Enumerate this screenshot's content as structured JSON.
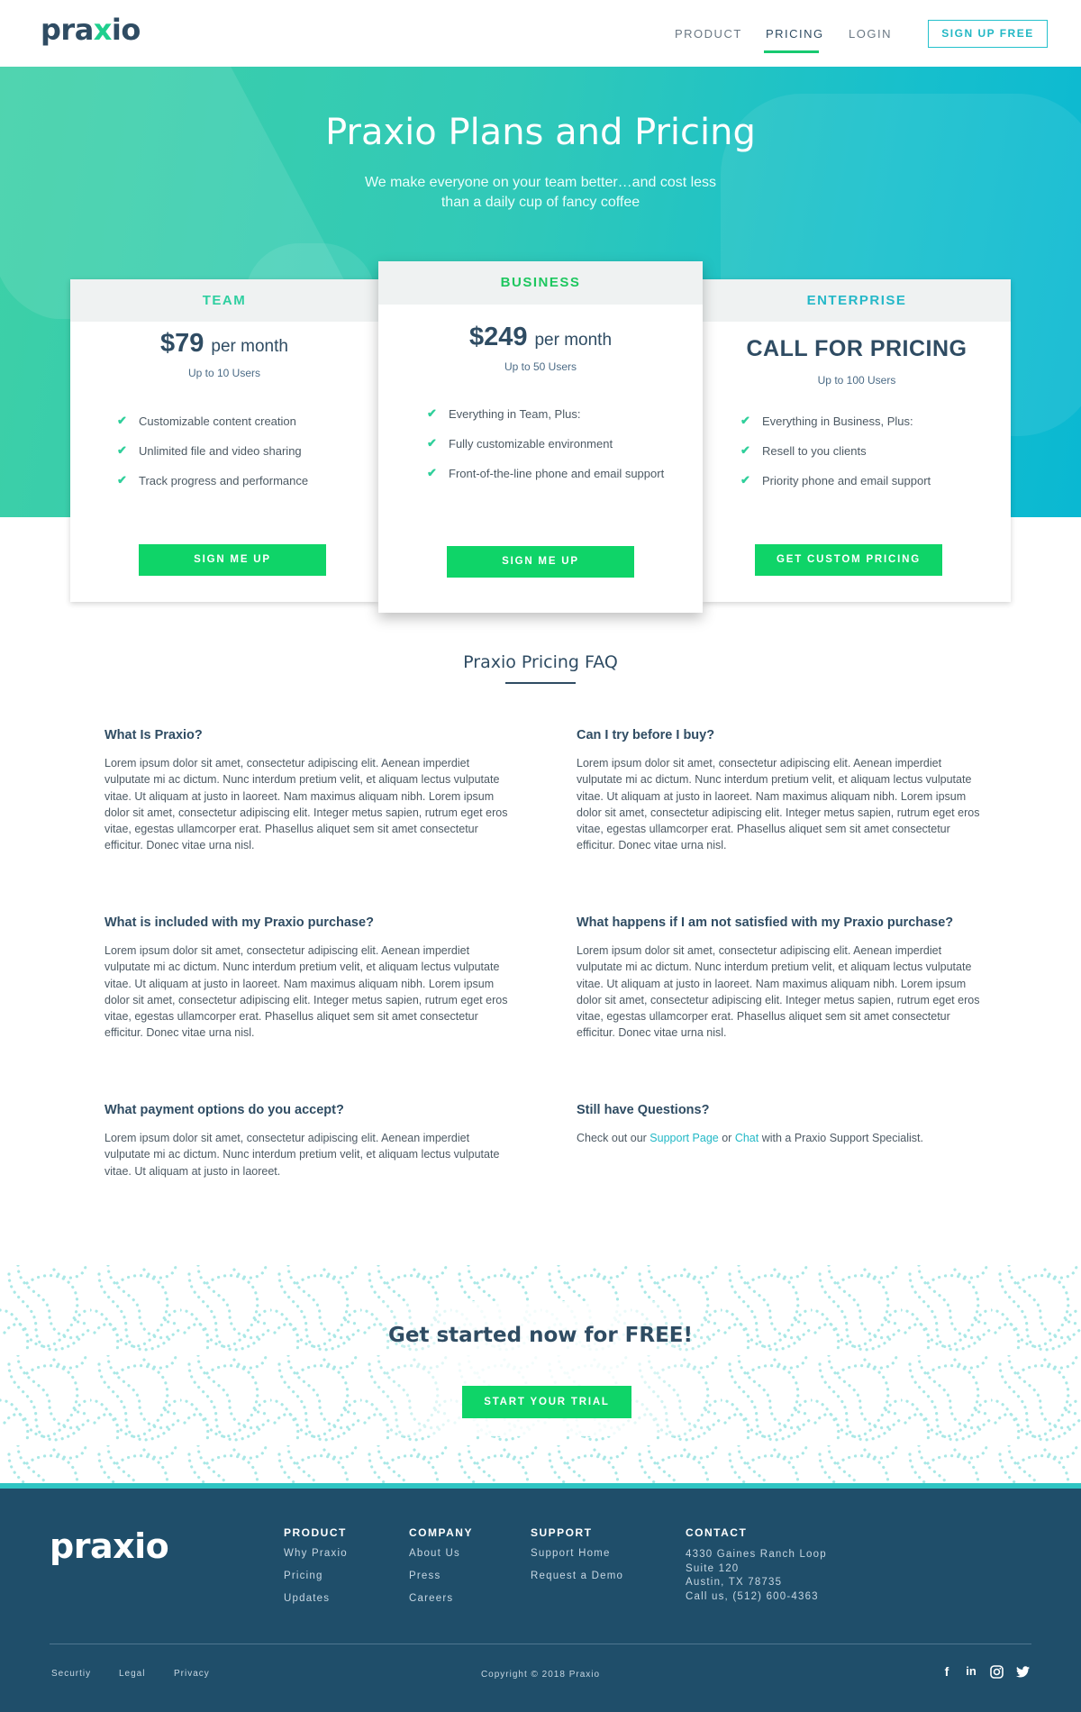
{
  "header": {
    "logo_pre": "pra",
    "logo_x": "x",
    "logo_post": "io",
    "nav": [
      "PRODUCT",
      "PRICING",
      "LOGIN"
    ],
    "signup": "SIGN UP FREE",
    "active_nav": "PRICING"
  },
  "hero": {
    "title": "Praxio Plans and Pricing",
    "subtitle": "We make everyone on your team better…and cost less than a daily cup of fancy coffee"
  },
  "plans": [
    {
      "name": "TEAM",
      "price": "$79",
      "per": "per month",
      "users": "Up to 10 Users",
      "features": [
        "Customizable content creation",
        "Unlimited file and video sharing",
        "Track progress and performance"
      ],
      "button": "SIGN ME UP"
    },
    {
      "name": "BUSINESS",
      "price": "$249",
      "per": "per month",
      "users": "Up to 50 Users",
      "features": [
        "Everything in Team, Plus:",
        "Fully customizable environment",
        "Front-of-the-line phone and email support"
      ],
      "button": "SIGN ME UP"
    },
    {
      "name": "ENTERPRISE",
      "price_text": "CALL FOR PRICING",
      "users": "Up to 100 Users",
      "features": [
        "Everything in Business, Plus:",
        "Resell to you clients",
        "Priority phone and email support"
      ],
      "button": "GET CUSTOM PRICING"
    }
  ],
  "faq": {
    "title": "Praxio Pricing FAQ",
    "items": [
      {
        "q": "What Is Praxio?",
        "a": "Lorem ipsum dolor sit amet, consectetur adipiscing elit. Aenean imperdiet vulputate mi ac dictum. Nunc interdum pretium velit, et aliquam lectus vulputate vitae. Ut aliquam at justo in laoreet. Nam maximus aliquam nibh. Lorem ipsum dolor sit amet, consectetur adipiscing elit. Integer metus sapien, rutrum eget eros vitae, egestas ullamcorper erat. Phasellus aliquet sem sit amet consectetur efficitur. Donec vitae urna nisl."
      },
      {
        "q": "Can I try before I buy?",
        "a": "Lorem ipsum dolor sit amet, consectetur adipiscing elit. Aenean imperdiet vulputate mi ac dictum. Nunc interdum pretium velit, et aliquam lectus vulputate vitae. Ut aliquam at justo in laoreet. Nam maximus aliquam nibh. Lorem ipsum dolor sit amet, consectetur adipiscing elit. Integer metus sapien, rutrum eget eros vitae, egestas ullamcorper erat. Phasellus aliquet sem sit amet consectetur efficitur. Donec vitae urna nisl."
      },
      {
        "q": "What is included with my Praxio purchase?",
        "a": "Lorem ipsum dolor sit amet, consectetur adipiscing elit. Aenean imperdiet vulputate mi ac dictum. Nunc interdum pretium velit, et aliquam lectus vulputate vitae. Ut aliquam at justo in laoreet. Nam maximus aliquam nibh. Lorem ipsum dolor sit amet, consectetur adipiscing elit. Integer metus sapien, rutrum eget eros vitae, egestas ullamcorper erat. Phasellus aliquet sem sit amet consectetur efficitur. Donec vitae urna nisl."
      },
      {
        "q": "What happens if I am not satisfied with my Praxio purchase?",
        "a": "Lorem ipsum dolor sit amet, consectetur adipiscing elit. Aenean imperdiet vulputate mi ac dictum. Nunc interdum pretium velit, et aliquam lectus vulputate vitae. Ut aliquam at justo in laoreet. Nam maximus aliquam nibh. Lorem ipsum dolor sit amet, consectetur adipiscing elit. Integer metus sapien, rutrum eget eros vitae, egestas ullamcorper erat. Phasellus aliquet sem sit amet consectetur efficitur. Donec vitae urna nisl."
      },
      {
        "q": "What payment options do you accept?",
        "a": "Lorem ipsum dolor sit amet, consectetur adipiscing elit. Aenean imperdiet vulputate mi ac dictum. Nunc interdum pretium velit, et aliquam lectus vulputate vitae. Ut aliquam at justo in laoreet."
      }
    ],
    "still": {
      "q": "Still have Questions?",
      "pre": "Check out our ",
      "link1": "Support Page",
      "mid": " or ",
      "link2": "Chat",
      "post": " with a Praxio Support Specialist."
    }
  },
  "cta": {
    "title": "Get started now for FREE!",
    "button": "START YOUR TRIAL"
  },
  "footer": {
    "logo_pre": "pra",
    "logo_x": "x",
    "logo_post": "io",
    "columns": [
      {
        "title": "PRODUCT",
        "links": [
          "Why Praxio",
          "Pricing",
          "Updates"
        ]
      },
      {
        "title": "COMPANY",
        "links": [
          "About Us",
          "Press",
          "Careers"
        ]
      },
      {
        "title": "SUPPORT",
        "links": [
          "Support Home",
          "Request a Demo"
        ]
      }
    ],
    "contact": {
      "title": "CONTACT",
      "lines": [
        "4330 Gaines Ranch Loop",
        "Suite 120",
        "Austin, TX 78735",
        "Call us, (512) 600-4363"
      ]
    },
    "legal": [
      "Securtiy",
      "Legal",
      "Privacy"
    ],
    "copyright": "Copyright © 2018 Praxio",
    "social_icons": [
      "facebook-icon",
      "linkedin-icon",
      "instagram-icon",
      "twitter-icon"
    ]
  },
  "colors": {
    "brand_navy": "#2f4c63",
    "accent_green": "#0fd468",
    "accent_teal": "#24c1cc",
    "footer_bg": "#1f4e6a"
  }
}
